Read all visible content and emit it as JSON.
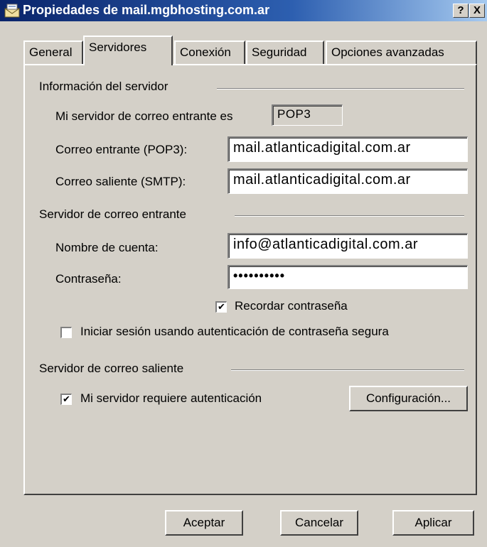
{
  "window": {
    "title": "Propiedades de mail.mgbhosting.com.ar",
    "help_button": "?",
    "close_button": "X"
  },
  "tabs": [
    {
      "label": "General",
      "active": false
    },
    {
      "label": "Servidores",
      "active": true
    },
    {
      "label": "Conexión",
      "active": false
    },
    {
      "label": "Seguridad",
      "active": false
    },
    {
      "label": "Opciones avanzadas",
      "active": false
    }
  ],
  "server_info": {
    "group_label": "Información del servidor",
    "incoming_type_label": "Mi servidor de correo entrante es",
    "incoming_type_value": "POP3",
    "incoming_label": "Correo entrante (POP3):",
    "incoming_value": "mail.atlanticadigital.com.ar",
    "outgoing_label": "Correo saliente (SMTP):",
    "outgoing_value": "mail.atlanticadigital.com.ar"
  },
  "incoming_server": {
    "group_label": "Servidor de correo entrante",
    "account_label": "Nombre de cuenta:",
    "account_value": "info@atlanticadigital.com.ar",
    "password_label": "Contraseña:",
    "password_value": "••••••••••",
    "remember_label": "Recordar contraseña",
    "remember_checked": true,
    "spa_label": "Iniciar sesión usando autenticación de contraseña segura",
    "spa_checked": false
  },
  "outgoing_server": {
    "group_label": "Servidor de correo saliente",
    "requires_auth_label": "Mi servidor requiere autenticación",
    "requires_auth_checked": true,
    "settings_button": "Configuración..."
  },
  "footer": {
    "ok_button": "Aceptar",
    "cancel_button": "Cancelar",
    "apply_button": "Aplicar"
  },
  "check_mark": "✔"
}
